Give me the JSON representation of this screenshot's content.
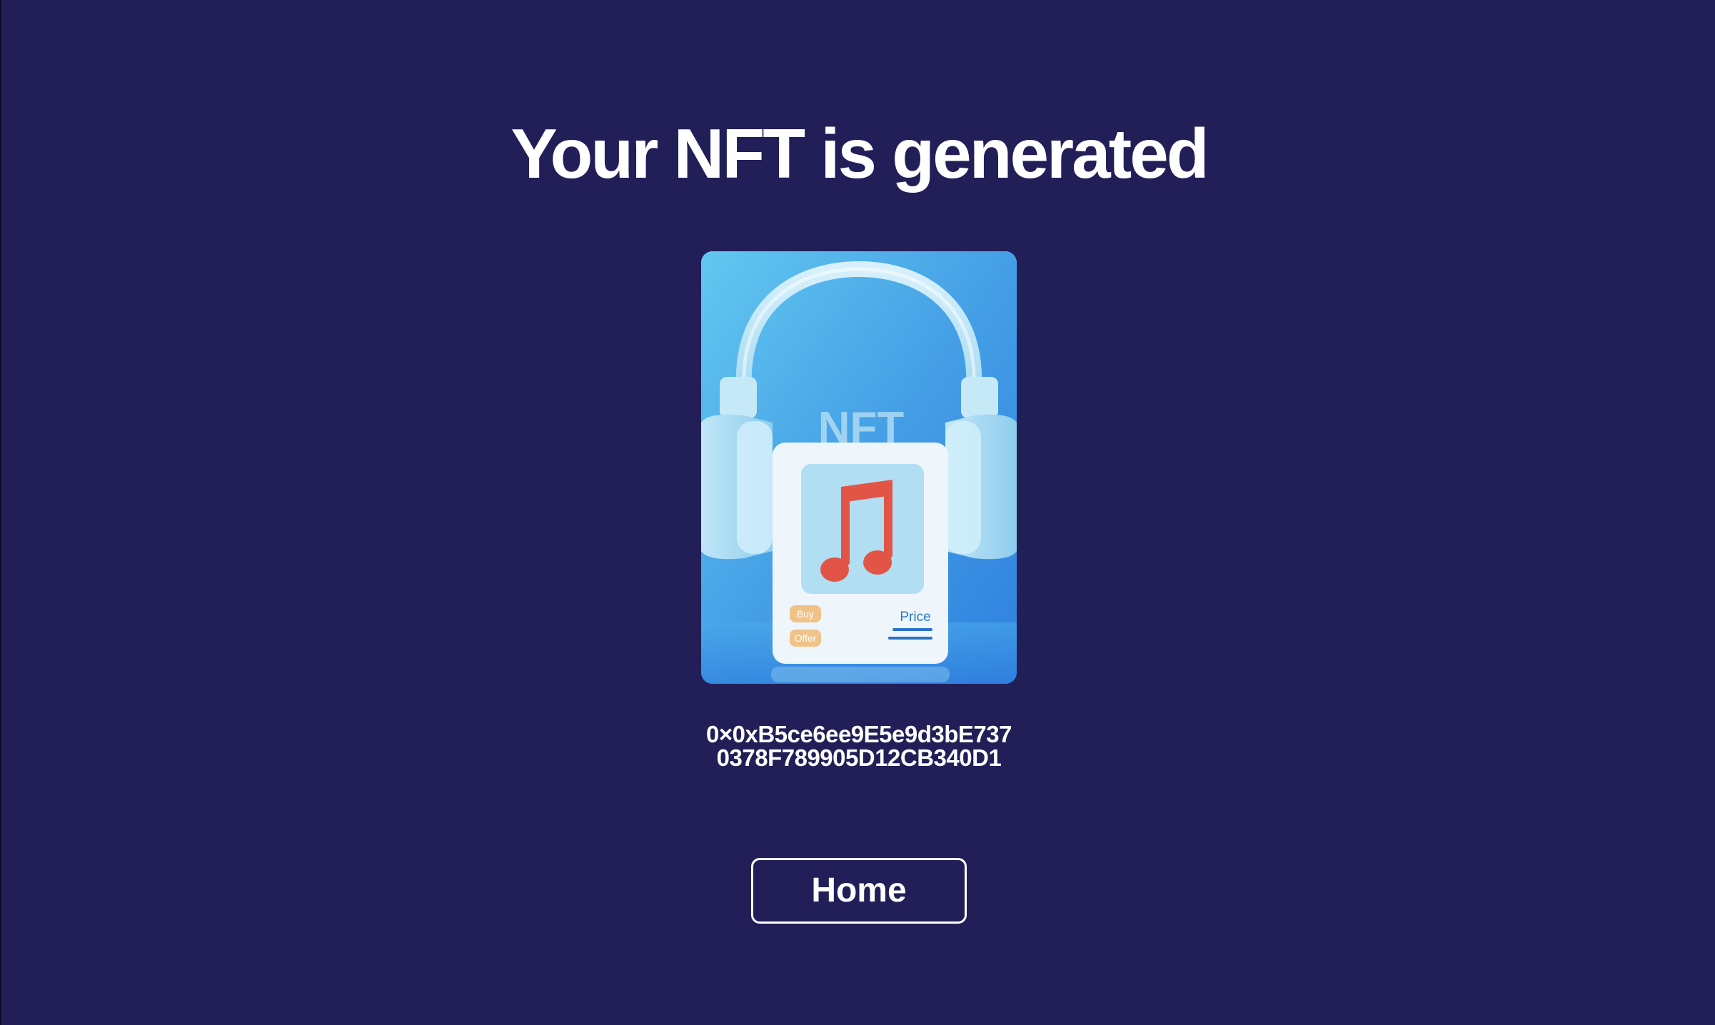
{
  "page": {
    "title": "Your NFT is generated",
    "background_color": "#221f58"
  },
  "nft_image": {
    "overlay_text": "NFT",
    "buy_label": "Buy",
    "offer_label": "Offer",
    "price_label": "Price",
    "icon": "music-note-icon"
  },
  "nft": {
    "address_line1": "0×0xB5ce6ee9E5e9d3bE737",
    "address_line2": "0378F789905D12CB340D1"
  },
  "actions": {
    "home_label": "Home"
  }
}
